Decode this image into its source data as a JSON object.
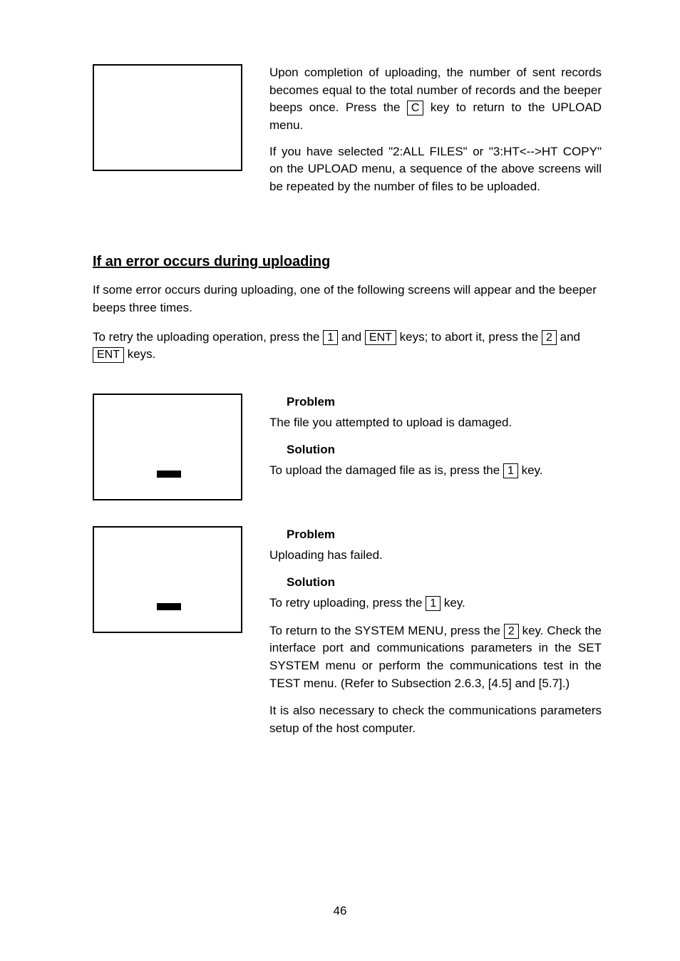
{
  "top": {
    "para1_before": "Upon completion of uploading, the number of sent records becomes equal to the total number of records and the beeper beeps once.  Press the ",
    "key_c": "C",
    "para1_after": " key to return to the UPLOAD menu.",
    "para2": "If you have selected \"2:ALL FILES\" or \"3:HT<-->HT COPY\" on the UPLOAD menu, a sequence of the above screens will be repeated by the number of files to be uploaded."
  },
  "heading": "If an error occurs during uploading",
  "intro1": "If some error occurs during uploading, one of the following screens will appear and the beeper beeps three times.",
  "intro2_a": "To retry the uploading operation, press  the ",
  "key_1": "1",
  "intro2_b": " and ",
  "key_ent": "ENT",
  "intro2_c": " keys; to abort it, press the ",
  "key_2": "2",
  "intro2_d": " and ",
  "intro2_e": " keys.",
  "block1": {
    "problem_h": "Problem",
    "problem_t": "The file you attempted to upload is damaged.",
    "solution_h": "Solution",
    "solution_before": "To upload the damaged file as is, press the ",
    "solution_after": " key."
  },
  "block2": {
    "problem_h": "Problem",
    "problem_t": "Uploading has failed.",
    "solution_h": "Solution",
    "line1_before": "To retry uploading, press the  ",
    "line1_after": "  key.",
    "line2_before": "To return to the SYSTEM MENU, press the ",
    "line2_after": " key. Check the interface port and communications parameters in the SET SYSTEM menu or perform the communications test in the TEST menu.  (Refer to Subsection 2.6.3, [4.5] and [5.7].)",
    "line3": "It is also necessary to check the communications parameters setup of the host computer."
  },
  "page": "46"
}
